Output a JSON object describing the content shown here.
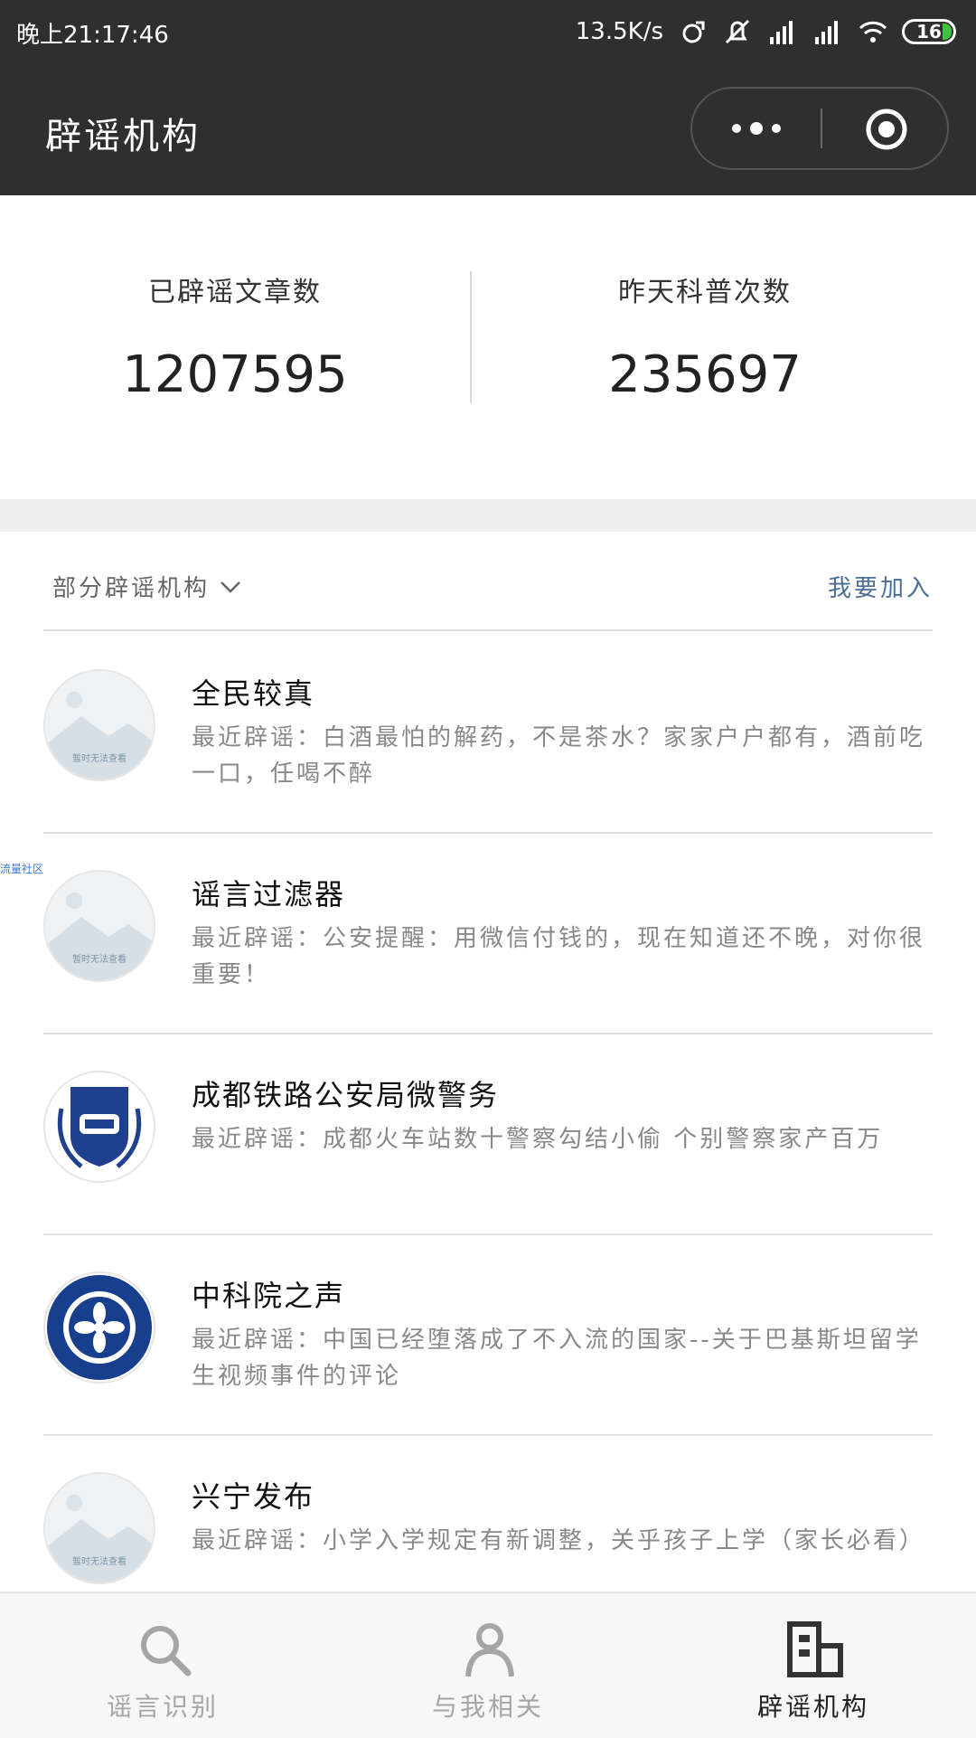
{
  "status_bar": {
    "time": "晚上21:17:46",
    "network_speed": "13.5K/s",
    "battery": "16",
    "battery_color": "#3ec33e"
  },
  "nav": {
    "title": "辟谣机构"
  },
  "stats": {
    "left_label": "已辟谣文章数",
    "left_value": "1207595",
    "right_label": "昨天科普次数",
    "right_value": "235697"
  },
  "list_header": {
    "title": "部分辟谣机构",
    "join_label": "我要加入",
    "accent_color": "#4a6e94"
  },
  "placeholder_text": "暂时无法查看",
  "side_label": "流量社区",
  "organizations": [
    {
      "name": "全民较真",
      "desc": "最近辟谣：白酒最怕的解药，不是茶水？家家户户都有，酒前吃一口，任喝不醉"
    },
    {
      "name": "谣言过滤器",
      "desc": "最近辟谣：公安提醒：用微信付钱的，现在知道还不晚，对你很重要！"
    },
    {
      "name": "成都铁路公安局微警务",
      "desc": "最近辟谣：成都火车站数十警察勾结小偷 个别警察家产百万"
    },
    {
      "name": "中科院之声",
      "desc": "最近辟谣：中国已经堕落成了不入流的国家--关于巴基斯坦留学生视频事件的评论"
    },
    {
      "name": "兴宁发布",
      "desc": "最近辟谣：小学入学规定有新调整，关乎孩子上学（家长必看）"
    }
  ],
  "tabs": [
    {
      "label": "谣言识别",
      "icon": "search-icon",
      "active": false
    },
    {
      "label": "与我相关",
      "icon": "person-icon",
      "active": false
    },
    {
      "label": "辟谣机构",
      "icon": "building-icon",
      "active": true
    }
  ]
}
